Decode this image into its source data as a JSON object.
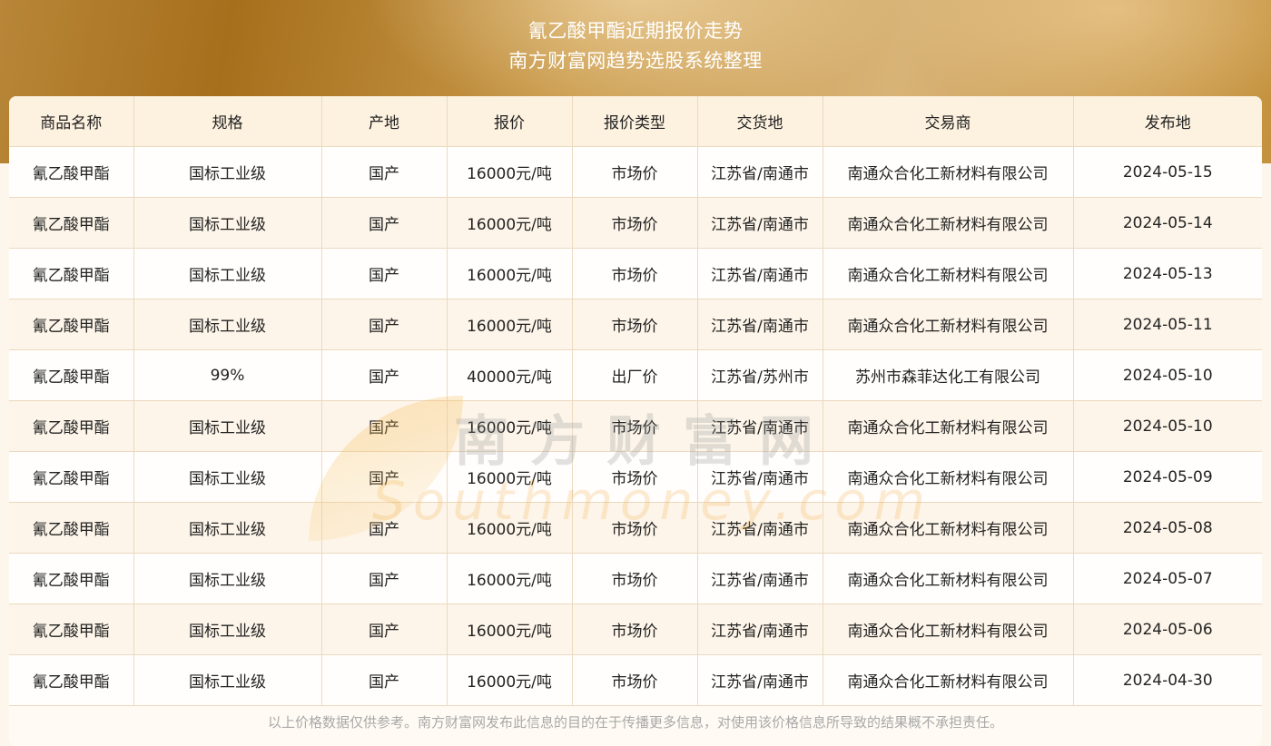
{
  "header": {
    "title": "氰乙酸甲酯近期报价走势",
    "subtitle": "南方财富网趋势选股系统整理"
  },
  "table": {
    "columns": [
      "商品名称",
      "规格",
      "产地",
      "报价",
      "报价类型",
      "交货地",
      "交易商",
      "发布地"
    ],
    "rows": [
      [
        "氰乙酸甲酯",
        "国标工业级",
        "国产",
        "16000元/吨",
        "市场价",
        "江苏省/南通市",
        "南通众合化工新材料有限公司",
        "2024-05-15"
      ],
      [
        "氰乙酸甲酯",
        "国标工业级",
        "国产",
        "16000元/吨",
        "市场价",
        "江苏省/南通市",
        "南通众合化工新材料有限公司",
        "2024-05-14"
      ],
      [
        "氰乙酸甲酯",
        "国标工业级",
        "国产",
        "16000元/吨",
        "市场价",
        "江苏省/南通市",
        "南通众合化工新材料有限公司",
        "2024-05-13"
      ],
      [
        "氰乙酸甲酯",
        "国标工业级",
        "国产",
        "16000元/吨",
        "市场价",
        "江苏省/南通市",
        "南通众合化工新材料有限公司",
        "2024-05-11"
      ],
      [
        "氰乙酸甲酯",
        "99%",
        "国产",
        "40000元/吨",
        "出厂价",
        "江苏省/苏州市",
        "苏州市森菲达化工有限公司",
        "2024-05-10"
      ],
      [
        "氰乙酸甲酯",
        "国标工业级",
        "国产",
        "16000元/吨",
        "市场价",
        "江苏省/南通市",
        "南通众合化工新材料有限公司",
        "2024-05-10"
      ],
      [
        "氰乙酸甲酯",
        "国标工业级",
        "国产",
        "16000元/吨",
        "市场价",
        "江苏省/南通市",
        "南通众合化工新材料有限公司",
        "2024-05-09"
      ],
      [
        "氰乙酸甲酯",
        "国标工业级",
        "国产",
        "16000元/吨",
        "市场价",
        "江苏省/南通市",
        "南通众合化工新材料有限公司",
        "2024-05-08"
      ],
      [
        "氰乙酸甲酯",
        "国标工业级",
        "国产",
        "16000元/吨",
        "市场价",
        "江苏省/南通市",
        "南通众合化工新材料有限公司",
        "2024-05-07"
      ],
      [
        "氰乙酸甲酯",
        "国标工业级",
        "国产",
        "16000元/吨",
        "市场价",
        "江苏省/南通市",
        "南通众合化工新材料有限公司",
        "2024-05-06"
      ],
      [
        "氰乙酸甲酯",
        "国标工业级",
        "国产",
        "16000元/吨",
        "市场价",
        "江苏省/南通市",
        "南通众合化工新材料有限公司",
        "2024-04-30"
      ]
    ]
  },
  "watermark": {
    "cn": "南方财富网",
    "en": "Southmoney.com"
  },
  "footer": {
    "disclaimer": "以上价格数据仅供参考。南方财富网发布此信息的目的在于传播更多信息，对使用该价格信息所导致的结果概不承担责任。"
  },
  "colors": {
    "header_text": "#ffffff",
    "table_border": "#ecd9bf",
    "header_row_bg": "#fdf1df",
    "footer_text": "#a9a9a9"
  }
}
